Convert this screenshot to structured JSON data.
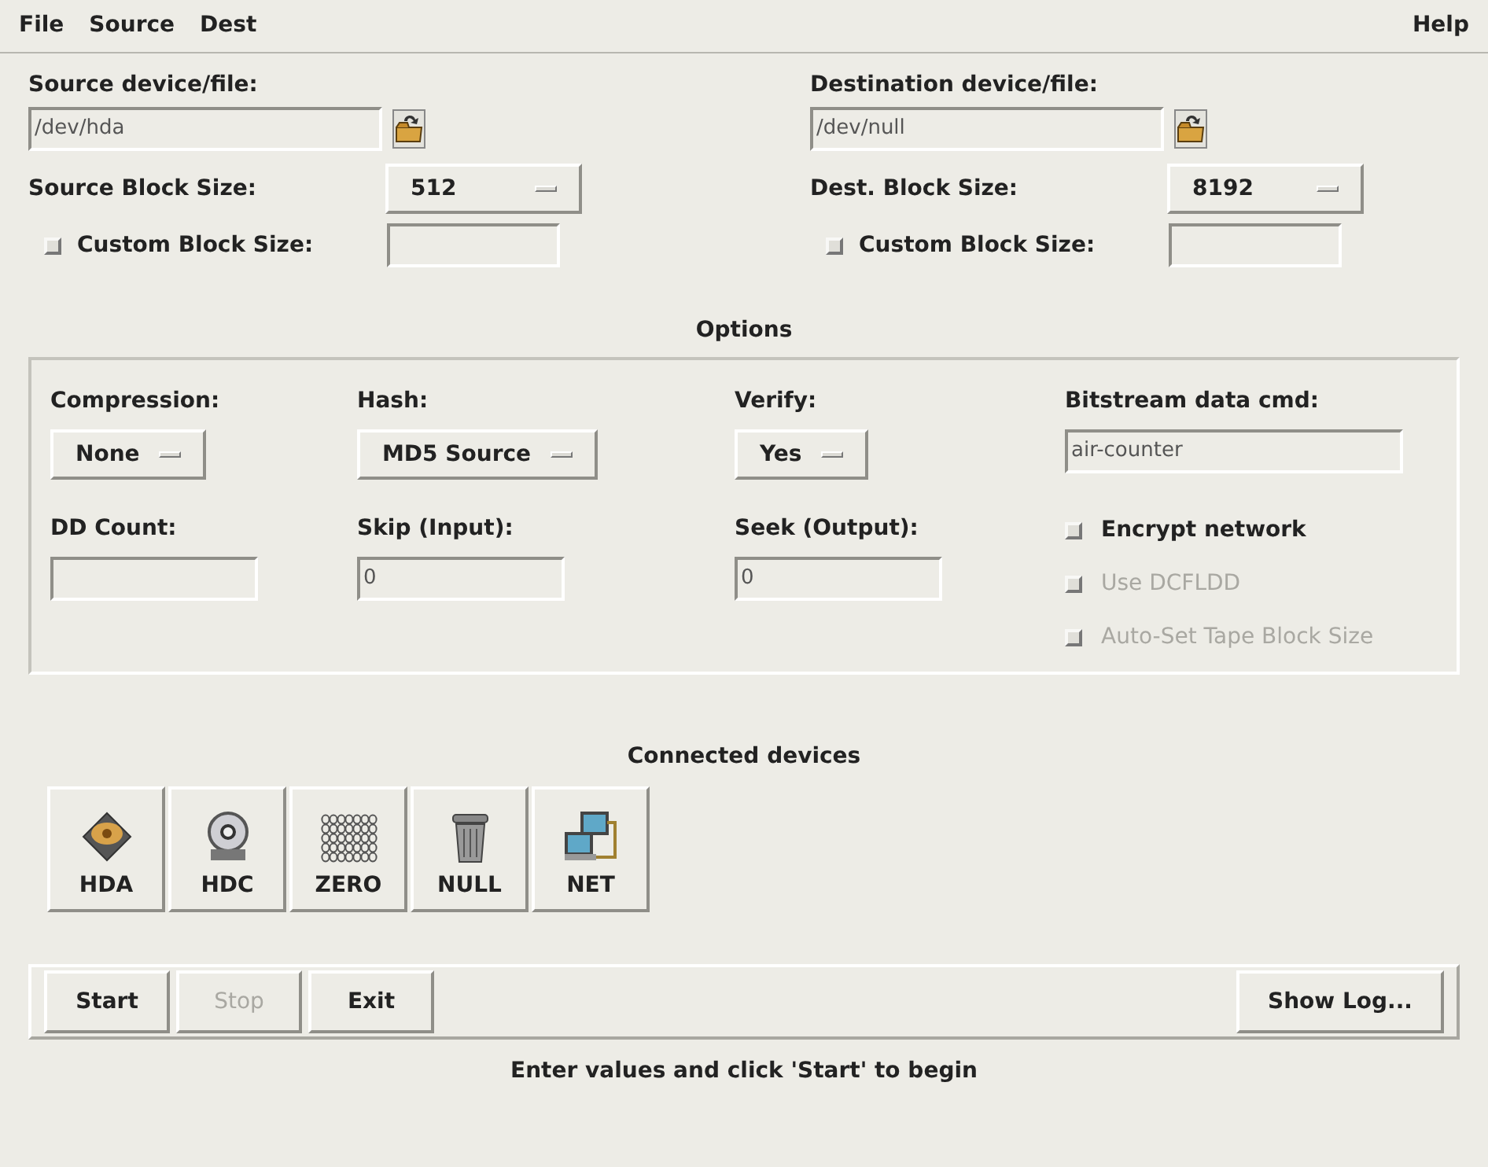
{
  "menu": {
    "left": [
      {
        "label": "File"
      },
      {
        "label": "Source"
      },
      {
        "label": "Dest"
      }
    ],
    "right": [
      {
        "label": "Help"
      }
    ]
  },
  "source": {
    "label": "Source device/file:",
    "value": "/dev/hda",
    "block_label": "Source Block Size:",
    "block_value": "512",
    "custom": {
      "label": "Custom Block Size:",
      "checked": false
    }
  },
  "dest": {
    "label": "Destination device/file:",
    "value": "/dev/null",
    "block_label": "Dest. Block Size:",
    "block_value": "8192",
    "custom": {
      "label": "Custom Block Size:",
      "checked": false
    }
  },
  "options": {
    "title": "Options",
    "fields": [
      {
        "kind": "dropdown",
        "label": "Compression:",
        "value": "None"
      },
      {
        "kind": "dropdown",
        "label": "Hash:",
        "value": "MD5 Source"
      },
      {
        "kind": "dropdown",
        "label": "Verify:",
        "value": "Yes"
      },
      {
        "kind": "text",
        "label": "Bitstream data cmd:",
        "value": "air-counter"
      },
      {
        "kind": "text",
        "label": "DD Count:"
      },
      {
        "kind": "text",
        "label": "Skip (Input):",
        "value": "0"
      },
      {
        "kind": "text",
        "label": "Seek (Output):",
        "value": "0"
      }
    ],
    "checkboxes": [
      {
        "label": "Encrypt network",
        "checked": false,
        "disabled": false
      },
      {
        "label": "Use DCFLDD",
        "checked": false,
        "disabled": true
      },
      {
        "label": "Auto-Set Tape Block Size",
        "checked": false,
        "disabled": true
      }
    ]
  },
  "devices": {
    "title": "Connected devices",
    "items": [
      {
        "kind": "disk",
        "label": "HDA"
      },
      {
        "kind": "cd",
        "label": "HDC"
      },
      {
        "kind": "zero",
        "label": "ZERO"
      },
      {
        "kind": "trash",
        "label": "NULL"
      },
      {
        "kind": "net",
        "label": "NET"
      }
    ]
  },
  "actions": [
    {
      "label": "Start",
      "disabled": false
    },
    {
      "label": "Stop",
      "disabled": true
    },
    {
      "label": "Exit",
      "disabled": false
    }
  ],
  "show_log": {
    "label": "Show Log..."
  },
  "status": "Enter values and click 'Start' to begin"
}
